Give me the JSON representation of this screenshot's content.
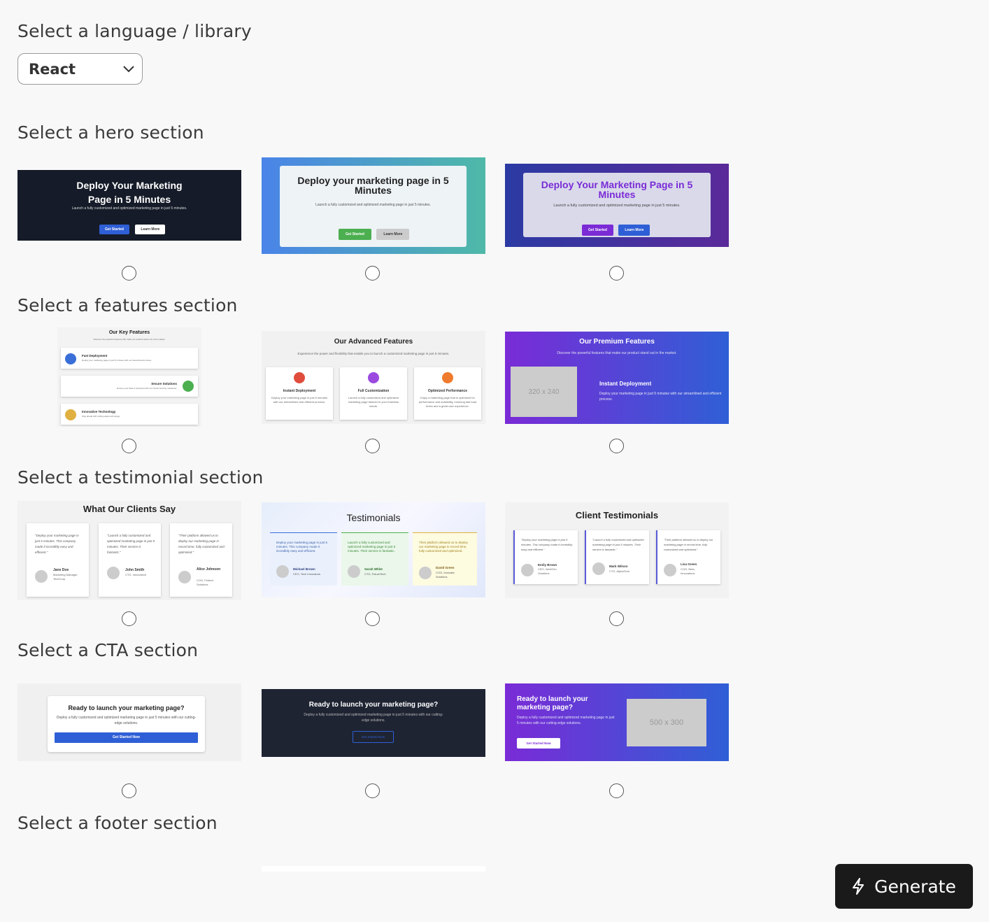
{
  "headings": {
    "language": "Select a language / library",
    "hero": "Select a hero section",
    "features": "Select a features section",
    "testimonial": "Select a testimonial section",
    "cta": "Select a CTA section",
    "footer": "Select a footer section"
  },
  "language_select": {
    "value": "React"
  },
  "generate_label": "Generate",
  "hero": [
    {
      "title": "Deploy Your Marketing Page in 5 Minutes",
      "sub": "Launch a fully customized and optimized marketing page in just 5 minutes.",
      "btn1": "Get Started",
      "btn2": "Learn More"
    },
    {
      "title": "Deploy your marketing page in 5 Minutes",
      "sub": "Launch a fully customized and optimized marketing page in just 5 minutes.",
      "btn1": "Get Started",
      "btn2": "Learn More"
    },
    {
      "title": "Deploy Your Marketing Page in 5 Minutes",
      "sub": "Launch a fully customized and optimized marketing page in just 5 minutes.",
      "btn1": "Get Started",
      "btn2": "Learn More"
    }
  ],
  "features": [
    {
      "title": "Our Key Features",
      "sub": "Discover the powerful features that make our product stand out in the market.",
      "items": [
        {
          "name": "Fast Deployment",
          "desc": "Deploy your marketing page in just 5 minutes with our streamlined process."
        },
        {
          "name": "Secure Solutions",
          "desc": "Ensure your data is protected with our robust security measures."
        },
        {
          "name": "Innovative Technology",
          "desc": "Stay ahead with cutting-edge technology."
        }
      ]
    },
    {
      "title": "Our Advanced Features",
      "sub": "Experience the power and flexibility that enable you to launch a customized marketing page in just 5 minutes.",
      "items": [
        {
          "name": "Instant Deployment",
          "desc": "Deploy your marketing page in just 5 minutes with our streamlined and efficient process."
        },
        {
          "name": "Full Customization",
          "desc": "Launch a fully customized and optimized marketing page tailored to your business needs."
        },
        {
          "name": "Optimized Performance",
          "desc": "Enjoy a marketing page that is optimized for performance and scalability, ensuring fast load times and a great user experience."
        }
      ]
    },
    {
      "title": "Our Premium Features",
      "sub": "Discover the powerful features that make our product stand out in the market.",
      "placeholder": "320 x 240",
      "items": [
        {
          "name": "Instant Deployment",
          "desc": "Deploy your marketing page in just 5 minutes with our streamlined and efficient process."
        }
      ]
    }
  ],
  "testimonials": [
    {
      "title": "What Our Clients Say",
      "items": [
        {
          "quote": "\"Deploy your marketing page in just 5 minutes. This company made it incredibly easy and efficient.\"",
          "name": "Jane Doe",
          "role": "Marketing Manager, TechCorp"
        },
        {
          "quote": "\"Launch a fully customized and optimized marketing page in just 5 minutes. Their service is fantastic.\"",
          "name": "John Smith",
          "role": "CTO, Innovatech"
        },
        {
          "quote": "\"Their platform allowed us to deploy our marketing page in record time, fully customized and optimized.\"",
          "name": "Alice Johnson",
          "role": "COO, Fintech Solutions"
        }
      ]
    },
    {
      "title": "Testimonials",
      "items": [
        {
          "quote": "Deploy your marketing page in just 5 minutes. This company made it incredibly easy and efficient.",
          "name": "Michael Brown",
          "role": "CEO, Tech Innovators"
        },
        {
          "quote": "Launch a fully customized and optimized marketing page in just 5 minutes. Their service is fantastic.",
          "name": "Sarah White",
          "role": "CTO, FutureTech"
        },
        {
          "quote": "Their platform allowed us to deploy our marketing page in record time, fully customized and optimized.",
          "name": "David Green",
          "role": "COO, Innovate Solutions"
        }
      ]
    },
    {
      "title": "Client Testimonials",
      "items": [
        {
          "quote": "\"Deploy your marketing page in just 5 minutes. This company made it incredibly easy and efficient.\"",
          "name": "Emily Brown",
          "role": "CEO, NextGen Solutions"
        },
        {
          "quote": "\"Launch a fully customized and optimized marketing page in just 5 minutes. Their service is fantastic.\"",
          "name": "Mark Wilson",
          "role": "CTO, AlphaTech"
        },
        {
          "quote": "\"Their platform allowed us to deploy our marketing page in record time, fully customized and optimized.\"",
          "name": "Lisa Green",
          "role": "COO, Beta Innovations"
        }
      ]
    }
  ],
  "cta": [
    {
      "title": "Ready to launch your marketing page?",
      "sub": "Deploy a fully customized and optimized marketing page in just 5 minutes with our cutting-edge solutions.",
      "btn": "Get Started Now"
    },
    {
      "title": "Ready to launch your marketing page?",
      "sub": "Deploy a fully customized and optimized marketing page in just 5 minutes with our cutting-edge solutions.",
      "btn": "Get Started Now"
    },
    {
      "title": "Ready to launch your marketing page?",
      "sub": "Deploy a fully customized and optimized marketing page in just 5 minutes with our cutting-edge solutions.",
      "btn": "Get Started Now",
      "placeholder": "500 x 300"
    }
  ],
  "colors": {
    "accent_blue": "#2f5fd6",
    "dark": "#1f2433",
    "purple": "#7a2bd6"
  }
}
